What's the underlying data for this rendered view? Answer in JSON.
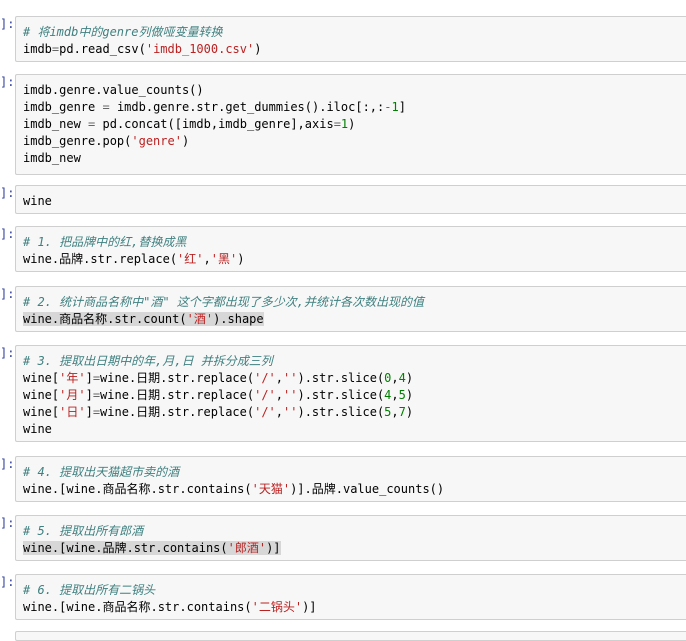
{
  "prompt_glyph": "]:",
  "cells": [
    {
      "lines": [
        [
          {
            "t": "comment",
            "v": "# 将imdb中的genre列做哑变量转换"
          }
        ],
        [
          {
            "t": "plain",
            "v": "imdb"
          },
          {
            "t": "op",
            "v": "="
          },
          {
            "t": "plain",
            "v": "pd.read_csv("
          },
          {
            "t": "str",
            "v": "'imdb_1000.csv'"
          },
          {
            "t": "plain",
            "v": ")"
          }
        ]
      ]
    },
    {
      "lines": [
        [
          {
            "t": "plain",
            "v": "imdb.genre.value_counts()"
          }
        ],
        [
          {
            "t": "plain",
            "v": "imdb_genre "
          },
          {
            "t": "op",
            "v": "="
          },
          {
            "t": "plain",
            "v": " imdb.genre.str.get_dummies().iloc[:,:"
          },
          {
            "t": "op",
            "v": "-"
          },
          {
            "t": "num",
            "v": "1"
          },
          {
            "t": "plain",
            "v": "]"
          }
        ],
        [
          {
            "t": "plain",
            "v": "imdb_new "
          },
          {
            "t": "op",
            "v": "="
          },
          {
            "t": "plain",
            "v": " pd.concat([imdb,imdb_genre],axis"
          },
          {
            "t": "op",
            "v": "="
          },
          {
            "t": "num",
            "v": "1"
          },
          {
            "t": "plain",
            "v": ")"
          }
        ],
        [
          {
            "t": "plain",
            "v": "imdb_genre.pop("
          },
          {
            "t": "str",
            "v": "'genre'"
          },
          {
            "t": "plain",
            "v": ")"
          }
        ],
        [
          {
            "t": "plain",
            "v": "imdb_new"
          }
        ]
      ]
    },
    {
      "lines": [
        [
          {
            "t": "plain",
            "v": "wine"
          }
        ]
      ]
    },
    {
      "lines": [
        [
          {
            "t": "comment",
            "v": "# 1. 把品牌中的红,替换成黑"
          }
        ],
        [
          {
            "t": "plain",
            "v": "wine.品牌.str.replace("
          },
          {
            "t": "str",
            "v": "'红'"
          },
          {
            "t": "plain",
            "v": ","
          },
          {
            "t": "str",
            "v": "'黑'"
          },
          {
            "t": "plain",
            "v": ")"
          }
        ]
      ]
    },
    {
      "lines": [
        [
          {
            "t": "comment",
            "v": "# 2. 统计商品名称中\"酒\" 这个字都出现了多少次,并统计各次数出现的值"
          }
        ],
        [
          {
            "t": "hl",
            "v": "wine.商品名称.str.count("
          },
          {
            "t": "hlstr",
            "v": "'酒'"
          },
          {
            "t": "hl",
            "v": ").shape"
          }
        ]
      ]
    },
    {
      "lines": [
        [
          {
            "t": "comment",
            "v": "# 3. 提取出日期中的年,月,日 并拆分成三列"
          }
        ],
        [
          {
            "t": "plain",
            "v": "wine["
          },
          {
            "t": "str",
            "v": "'年'"
          },
          {
            "t": "plain",
            "v": "]"
          },
          {
            "t": "op",
            "v": "="
          },
          {
            "t": "plain",
            "v": "wine.日期.str.replace("
          },
          {
            "t": "str",
            "v": "'/'"
          },
          {
            "t": "plain",
            "v": ","
          },
          {
            "t": "str",
            "v": "''"
          },
          {
            "t": "plain",
            "v": ").str.slice("
          },
          {
            "t": "num",
            "v": "0"
          },
          {
            "t": "plain",
            "v": ","
          },
          {
            "t": "num",
            "v": "4"
          },
          {
            "t": "plain",
            "v": ")"
          }
        ],
        [
          {
            "t": "plain",
            "v": "wine["
          },
          {
            "t": "str",
            "v": "'月'"
          },
          {
            "t": "plain",
            "v": "]"
          },
          {
            "t": "op",
            "v": "="
          },
          {
            "t": "plain",
            "v": "wine.日期.str.replace("
          },
          {
            "t": "str",
            "v": "'/'"
          },
          {
            "t": "plain",
            "v": ","
          },
          {
            "t": "str",
            "v": "''"
          },
          {
            "t": "plain",
            "v": ").str.slice("
          },
          {
            "t": "num",
            "v": "4"
          },
          {
            "t": "plain",
            "v": ","
          },
          {
            "t": "num",
            "v": "5"
          },
          {
            "t": "plain",
            "v": ")"
          }
        ],
        [
          {
            "t": "plain",
            "v": "wine["
          },
          {
            "t": "str",
            "v": "'日'"
          },
          {
            "t": "plain",
            "v": "]"
          },
          {
            "t": "op",
            "v": "="
          },
          {
            "t": "plain",
            "v": "wine.日期.str.replace("
          },
          {
            "t": "str",
            "v": "'/'"
          },
          {
            "t": "plain",
            "v": ","
          },
          {
            "t": "str",
            "v": "''"
          },
          {
            "t": "plain",
            "v": ").str.slice("
          },
          {
            "t": "num",
            "v": "5"
          },
          {
            "t": "plain",
            "v": ","
          },
          {
            "t": "num",
            "v": "7"
          },
          {
            "t": "plain",
            "v": ")"
          }
        ],
        [
          {
            "t": "plain",
            "v": "wine"
          }
        ]
      ]
    },
    {
      "lines": [
        [
          {
            "t": "comment",
            "v": "# 4. 提取出天猫超市卖的酒"
          }
        ],
        [
          {
            "t": "plain",
            "v": "wine.[wine.商品名称.str.contains("
          },
          {
            "t": "str",
            "v": "'天猫'"
          },
          {
            "t": "plain",
            "v": ")].品牌.value_counts()"
          }
        ]
      ]
    },
    {
      "lines": [
        [
          {
            "t": "comment",
            "v": "# 5. 提取出所有郎酒"
          }
        ],
        [
          {
            "t": "hl",
            "v": "wine.[wine.品牌.str.contains("
          },
          {
            "t": "hlstr",
            "v": "'郎酒'"
          },
          {
            "t": "hl",
            "v": ")]"
          }
        ]
      ]
    },
    {
      "lines": [
        [
          {
            "t": "comment",
            "v": "# 6. 提取出所有二锅头"
          }
        ],
        [
          {
            "t": "plain",
            "v": "wine.[wine.商品名称.str.contains("
          },
          {
            "t": "str",
            "v": "'二锅头'"
          },
          {
            "t": "plain",
            "v": ")]"
          }
        ]
      ]
    }
  ]
}
